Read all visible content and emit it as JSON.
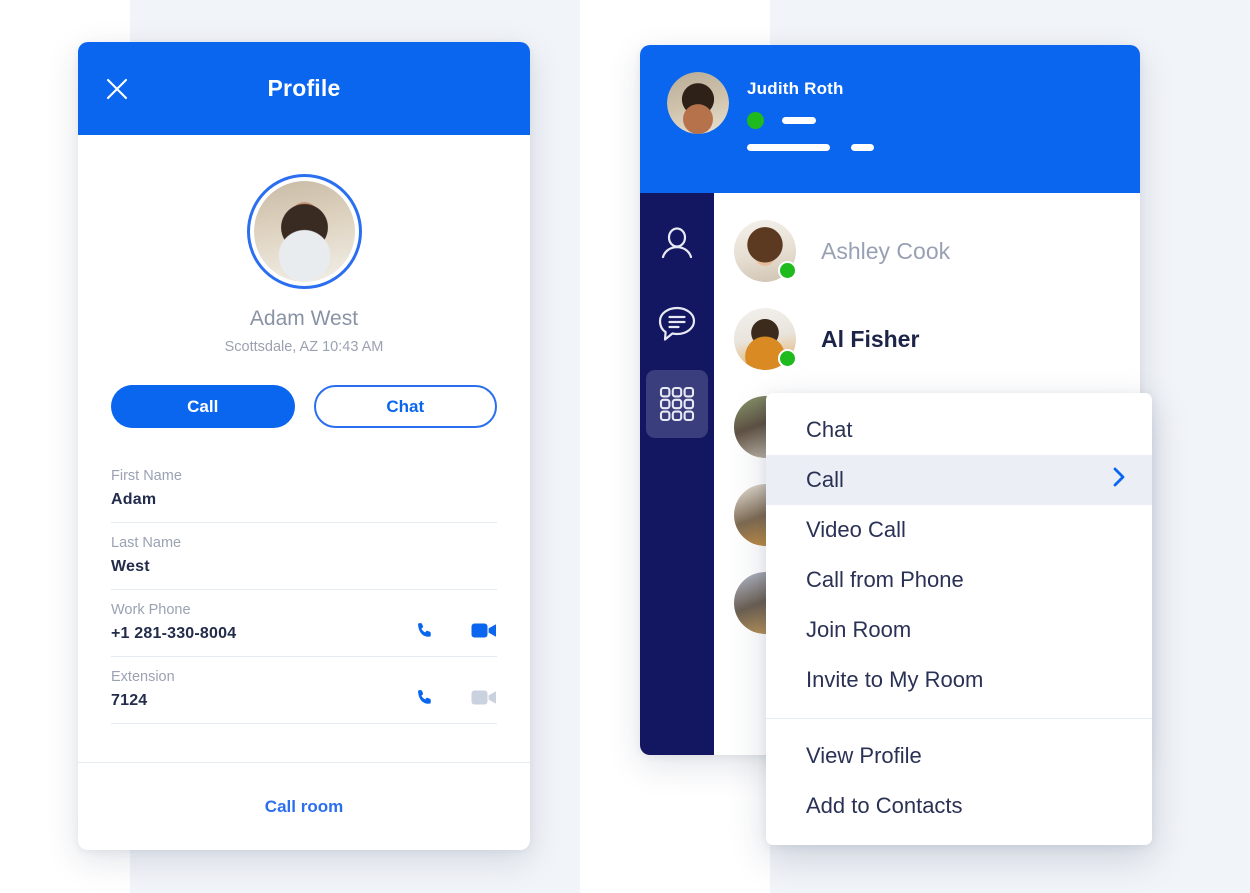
{
  "theme": {
    "blue": "#0A66EF",
    "navy": "#131660",
    "green": "#1EBA1E",
    "highlight": "#EBEEF4",
    "panel_bg": "#F1F4F8"
  },
  "profile_card": {
    "header": {
      "title": "Profile",
      "close_icon": "close-icon"
    },
    "avatar": "adam-west-avatar",
    "name": "Adam West",
    "location": "Scottsdale, AZ 10:43 AM",
    "actions": {
      "call_label": "Call",
      "chat_label": "Chat"
    },
    "fields": [
      {
        "label": "First Name",
        "value": "Adam",
        "icons": []
      },
      {
        "label": "Last Name",
        "value": "West",
        "icons": []
      },
      {
        "label": "Work Phone",
        "value": "+1 281-330-8004",
        "icons": [
          "phone-icon",
          "video-icon"
        ]
      },
      {
        "label": "Extension",
        "value": "7124",
        "icons": [
          "phone-icon",
          "video-icon-disabled"
        ]
      }
    ],
    "footer": {
      "call_room_label": "Call room"
    }
  },
  "messenger_card": {
    "header": {
      "user_name": "Judith Roth",
      "avatar": "judith-roth-avatar",
      "presence": "online"
    },
    "nav_rail": [
      {
        "name": "contacts",
        "icon": "person-icon",
        "active": false
      },
      {
        "name": "chat",
        "icon": "chat-icon",
        "active": false
      },
      {
        "name": "dialpad",
        "icon": "dialpad-icon",
        "active": true
      }
    ],
    "contacts": [
      {
        "name": "Ashley Cook",
        "avatar": "ashley-cook-avatar",
        "presence": "online",
        "emphasis": "muted"
      },
      {
        "name": "Al Fisher",
        "avatar": "al-fisher-avatar",
        "presence": "online",
        "emphasis": "strong"
      },
      {
        "name": "",
        "avatar": "contact-3-avatar",
        "presence": "none",
        "emphasis": "muted"
      },
      {
        "name": "",
        "avatar": "contact-4-avatar",
        "presence": "none",
        "emphasis": "muted"
      },
      {
        "name": "",
        "avatar": "contact-5-avatar",
        "presence": "none",
        "emphasis": "muted"
      }
    ]
  },
  "context_menu": {
    "items_top": [
      {
        "label": "Chat",
        "highlighted": false,
        "submenu": false
      },
      {
        "label": "Call",
        "highlighted": true,
        "submenu": true
      },
      {
        "label": "Video Call",
        "highlighted": false,
        "submenu": false
      },
      {
        "label": "Call from Phone",
        "highlighted": false,
        "submenu": false
      },
      {
        "label": "Join Room",
        "highlighted": false,
        "submenu": false
      },
      {
        "label": "Invite to My Room",
        "highlighted": false,
        "submenu": false
      }
    ],
    "items_bottom": [
      {
        "label": "View Profile",
        "highlighted": false,
        "submenu": false
      },
      {
        "label": "Add to Contacts",
        "highlighted": false,
        "submenu": false
      }
    ]
  }
}
